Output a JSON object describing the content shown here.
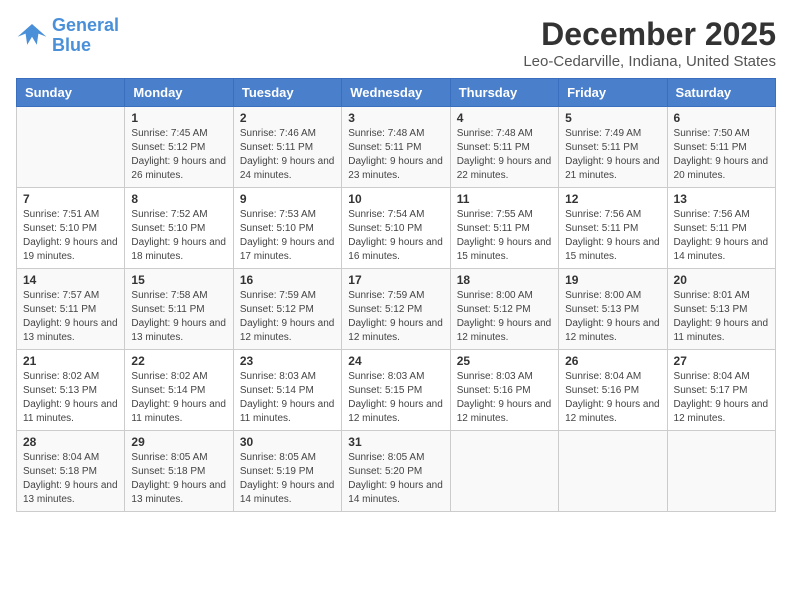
{
  "header": {
    "logo_line1": "General",
    "logo_line2": "Blue",
    "month": "December 2025",
    "location": "Leo-Cedarville, Indiana, United States"
  },
  "weekdays": [
    "Sunday",
    "Monday",
    "Tuesday",
    "Wednesday",
    "Thursday",
    "Friday",
    "Saturday"
  ],
  "weeks": [
    [
      {
        "day": "",
        "sunrise": "",
        "sunset": "",
        "daylight": ""
      },
      {
        "day": "1",
        "sunrise": "Sunrise: 7:45 AM",
        "sunset": "Sunset: 5:12 PM",
        "daylight": "Daylight: 9 hours and 26 minutes."
      },
      {
        "day": "2",
        "sunrise": "Sunrise: 7:46 AM",
        "sunset": "Sunset: 5:11 PM",
        "daylight": "Daylight: 9 hours and 24 minutes."
      },
      {
        "day": "3",
        "sunrise": "Sunrise: 7:48 AM",
        "sunset": "Sunset: 5:11 PM",
        "daylight": "Daylight: 9 hours and 23 minutes."
      },
      {
        "day": "4",
        "sunrise": "Sunrise: 7:48 AM",
        "sunset": "Sunset: 5:11 PM",
        "daylight": "Daylight: 9 hours and 22 minutes."
      },
      {
        "day": "5",
        "sunrise": "Sunrise: 7:49 AM",
        "sunset": "Sunset: 5:11 PM",
        "daylight": "Daylight: 9 hours and 21 minutes."
      },
      {
        "day": "6",
        "sunrise": "Sunrise: 7:50 AM",
        "sunset": "Sunset: 5:11 PM",
        "daylight": "Daylight: 9 hours and 20 minutes."
      }
    ],
    [
      {
        "day": "7",
        "sunrise": "Sunrise: 7:51 AM",
        "sunset": "Sunset: 5:10 PM",
        "daylight": "Daylight: 9 hours and 19 minutes."
      },
      {
        "day": "8",
        "sunrise": "Sunrise: 7:52 AM",
        "sunset": "Sunset: 5:10 PM",
        "daylight": "Daylight: 9 hours and 18 minutes."
      },
      {
        "day": "9",
        "sunrise": "Sunrise: 7:53 AM",
        "sunset": "Sunset: 5:10 PM",
        "daylight": "Daylight: 9 hours and 17 minutes."
      },
      {
        "day": "10",
        "sunrise": "Sunrise: 7:54 AM",
        "sunset": "Sunset: 5:10 PM",
        "daylight": "Daylight: 9 hours and 16 minutes."
      },
      {
        "day": "11",
        "sunrise": "Sunrise: 7:55 AM",
        "sunset": "Sunset: 5:11 PM",
        "daylight": "Daylight: 9 hours and 15 minutes."
      },
      {
        "day": "12",
        "sunrise": "Sunrise: 7:56 AM",
        "sunset": "Sunset: 5:11 PM",
        "daylight": "Daylight: 9 hours and 15 minutes."
      },
      {
        "day": "13",
        "sunrise": "Sunrise: 7:56 AM",
        "sunset": "Sunset: 5:11 PM",
        "daylight": "Daylight: 9 hours and 14 minutes."
      }
    ],
    [
      {
        "day": "14",
        "sunrise": "Sunrise: 7:57 AM",
        "sunset": "Sunset: 5:11 PM",
        "daylight": "Daylight: 9 hours and 13 minutes."
      },
      {
        "day": "15",
        "sunrise": "Sunrise: 7:58 AM",
        "sunset": "Sunset: 5:11 PM",
        "daylight": "Daylight: 9 hours and 13 minutes."
      },
      {
        "day": "16",
        "sunrise": "Sunrise: 7:59 AM",
        "sunset": "Sunset: 5:12 PM",
        "daylight": "Daylight: 9 hours and 12 minutes."
      },
      {
        "day": "17",
        "sunrise": "Sunrise: 7:59 AM",
        "sunset": "Sunset: 5:12 PM",
        "daylight": "Daylight: 9 hours and 12 minutes."
      },
      {
        "day": "18",
        "sunrise": "Sunrise: 8:00 AM",
        "sunset": "Sunset: 5:12 PM",
        "daylight": "Daylight: 9 hours and 12 minutes."
      },
      {
        "day": "19",
        "sunrise": "Sunrise: 8:00 AM",
        "sunset": "Sunset: 5:13 PM",
        "daylight": "Daylight: 9 hours and 12 minutes."
      },
      {
        "day": "20",
        "sunrise": "Sunrise: 8:01 AM",
        "sunset": "Sunset: 5:13 PM",
        "daylight": "Daylight: 9 hours and 11 minutes."
      }
    ],
    [
      {
        "day": "21",
        "sunrise": "Sunrise: 8:02 AM",
        "sunset": "Sunset: 5:13 PM",
        "daylight": "Daylight: 9 hours and 11 minutes."
      },
      {
        "day": "22",
        "sunrise": "Sunrise: 8:02 AM",
        "sunset": "Sunset: 5:14 PM",
        "daylight": "Daylight: 9 hours and 11 minutes."
      },
      {
        "day": "23",
        "sunrise": "Sunrise: 8:03 AM",
        "sunset": "Sunset: 5:14 PM",
        "daylight": "Daylight: 9 hours and 11 minutes."
      },
      {
        "day": "24",
        "sunrise": "Sunrise: 8:03 AM",
        "sunset": "Sunset: 5:15 PM",
        "daylight": "Daylight: 9 hours and 12 minutes."
      },
      {
        "day": "25",
        "sunrise": "Sunrise: 8:03 AM",
        "sunset": "Sunset: 5:16 PM",
        "daylight": "Daylight: 9 hours and 12 minutes."
      },
      {
        "day": "26",
        "sunrise": "Sunrise: 8:04 AM",
        "sunset": "Sunset: 5:16 PM",
        "daylight": "Daylight: 9 hours and 12 minutes."
      },
      {
        "day": "27",
        "sunrise": "Sunrise: 8:04 AM",
        "sunset": "Sunset: 5:17 PM",
        "daylight": "Daylight: 9 hours and 12 minutes."
      }
    ],
    [
      {
        "day": "28",
        "sunrise": "Sunrise: 8:04 AM",
        "sunset": "Sunset: 5:18 PM",
        "daylight": "Daylight: 9 hours and 13 minutes."
      },
      {
        "day": "29",
        "sunrise": "Sunrise: 8:05 AM",
        "sunset": "Sunset: 5:18 PM",
        "daylight": "Daylight: 9 hours and 13 minutes."
      },
      {
        "day": "30",
        "sunrise": "Sunrise: 8:05 AM",
        "sunset": "Sunset: 5:19 PM",
        "daylight": "Daylight: 9 hours and 14 minutes."
      },
      {
        "day": "31",
        "sunrise": "Sunrise: 8:05 AM",
        "sunset": "Sunset: 5:20 PM",
        "daylight": "Daylight: 9 hours and 14 minutes."
      },
      {
        "day": "",
        "sunrise": "",
        "sunset": "",
        "daylight": ""
      },
      {
        "day": "",
        "sunrise": "",
        "sunset": "",
        "daylight": ""
      },
      {
        "day": "",
        "sunrise": "",
        "sunset": "",
        "daylight": ""
      }
    ]
  ]
}
